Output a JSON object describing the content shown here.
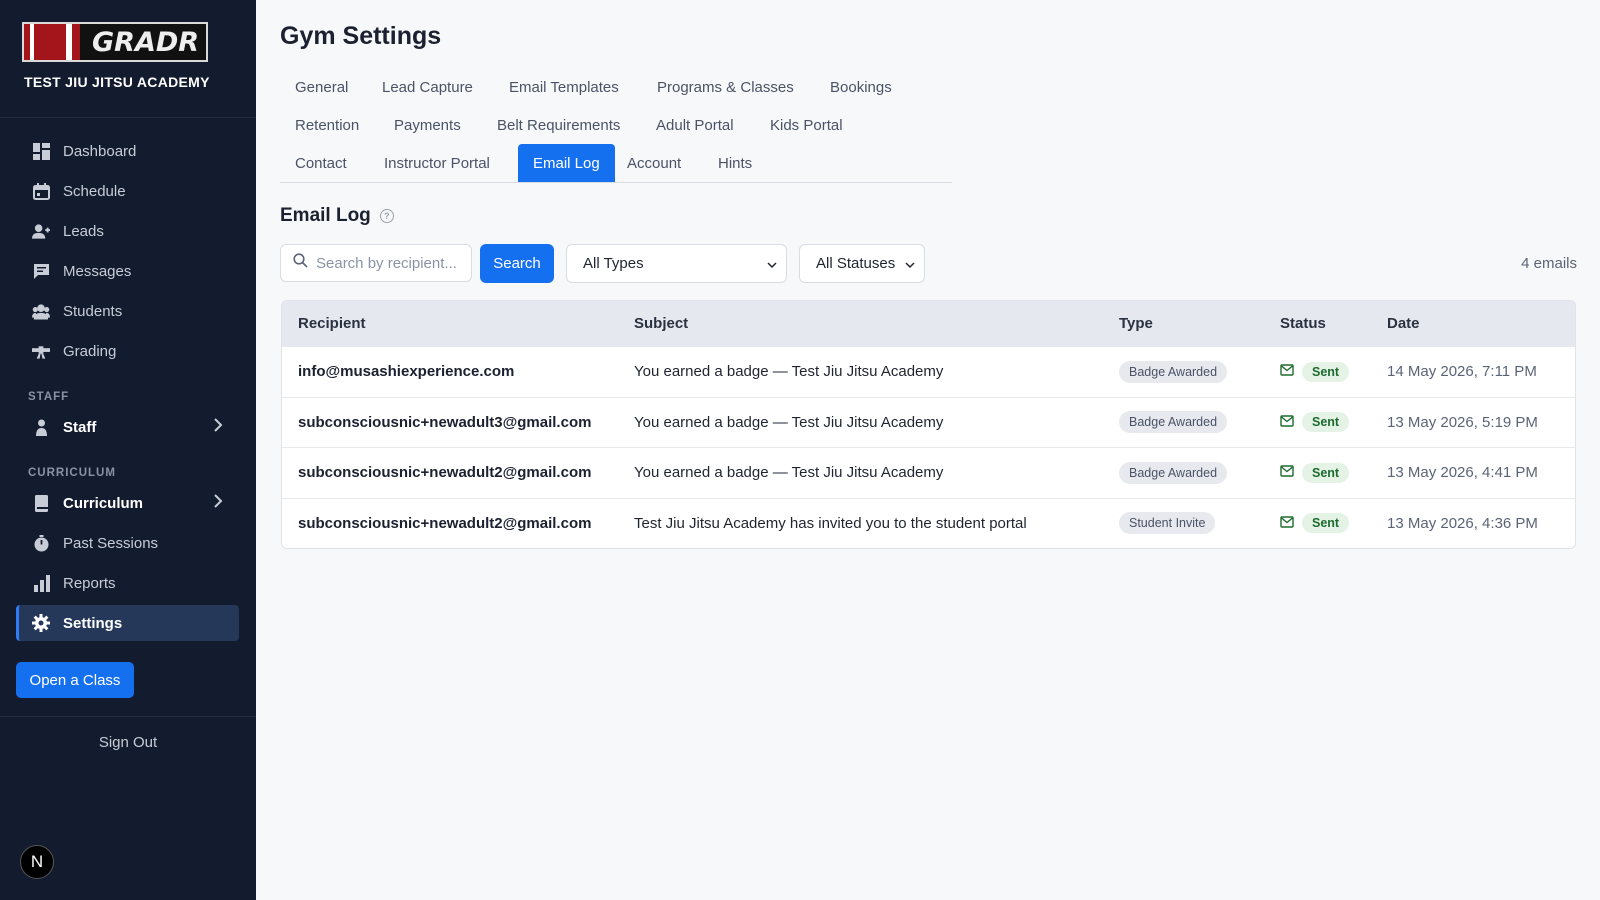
{
  "brand": {
    "logo_text": "GRADR",
    "academy_name": "TEST JIU JITSU ACADEMY"
  },
  "sidebar": {
    "items": [
      {
        "label": "Dashboard",
        "icon": "dashboard-icon"
      },
      {
        "label": "Schedule",
        "icon": "calendar-icon"
      },
      {
        "label": "Leads",
        "icon": "user-plus-icon"
      },
      {
        "label": "Messages",
        "icon": "message-icon"
      },
      {
        "label": "Students",
        "icon": "students-icon"
      },
      {
        "label": "Grading",
        "icon": "belt-icon"
      }
    ],
    "staff_section": "STAFF",
    "staff_item": "Staff",
    "curriculum_section": "CURRICULUM",
    "curriculum_item": "Curriculum",
    "past_sessions": "Past Sessions",
    "reports": "Reports",
    "settings": "Settings",
    "open_class": "Open a Class",
    "sign_out": "Sign Out",
    "avatar_letter": "N"
  },
  "main": {
    "title": "Gym Settings",
    "tabs": [
      "General",
      "Lead Capture",
      "Email Templates",
      "Programs & Classes",
      "Bookings",
      "Retention",
      "Payments",
      "Belt Requirements",
      "Adult Portal",
      "Kids Portal",
      "Contact",
      "Instructor Portal",
      "Email Log",
      "Account",
      "Hints"
    ],
    "active_tab": "Email Log",
    "section_title": "Email Log",
    "search": {
      "placeholder": "Search by recipient...",
      "button": "Search"
    },
    "filters": {
      "type": "All Types",
      "status": "All Statuses"
    },
    "count": "4 emails",
    "table": {
      "headers": [
        "Recipient",
        "Subject",
        "Type",
        "Status",
        "Date"
      ],
      "rows": [
        {
          "recipient": "info@musashiexperience.com",
          "subject": "You earned a badge — Test Jiu Jitsu Academy",
          "type": "Badge Awarded",
          "status": "Sent",
          "date": "14 May 2026, 7:11 PM"
        },
        {
          "recipient": "subconsciousnic+newadult3@gmail.com",
          "subject": "You earned a badge — Test Jiu Jitsu Academy",
          "type": "Badge Awarded",
          "status": "Sent",
          "date": "13 May 2026, 5:19 PM"
        },
        {
          "recipient": "subconsciousnic+newadult2@gmail.com",
          "subject": "You earned a badge — Test Jiu Jitsu Academy",
          "type": "Badge Awarded",
          "status": "Sent",
          "date": "13 May 2026, 4:41 PM"
        },
        {
          "recipient": "subconsciousnic+newadult2@gmail.com",
          "subject": "Test Jiu Jitsu Academy has invited you to the student portal",
          "type": "Student Invite",
          "status": "Sent",
          "date": "13 May 2026, 4:36 PM"
        }
      ]
    }
  },
  "colors": {
    "sidebar_bg": "#131c2e",
    "accent": "#1570ef",
    "sent": "#1d6b2e"
  }
}
